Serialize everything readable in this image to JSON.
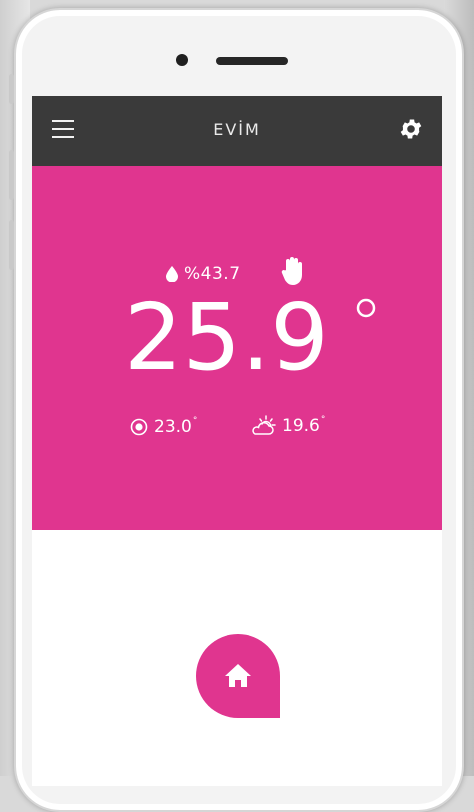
{
  "app": {
    "title": "EVİM"
  },
  "status": {
    "humidity": "%43.7",
    "current_temperature": "25.9",
    "target_temperature": "23.0",
    "outdoor_temperature": "19.6"
  },
  "icons": {
    "menu": "menu-icon",
    "settings": "gear-icon",
    "humidity": "drop-icon",
    "manual_mode": "hand-icon",
    "target": "target-icon",
    "weather": "partly-cloudy-icon",
    "home": "home-icon"
  },
  "colors": {
    "accent": "#e0358f",
    "app_bar": "#3a3a3a"
  }
}
